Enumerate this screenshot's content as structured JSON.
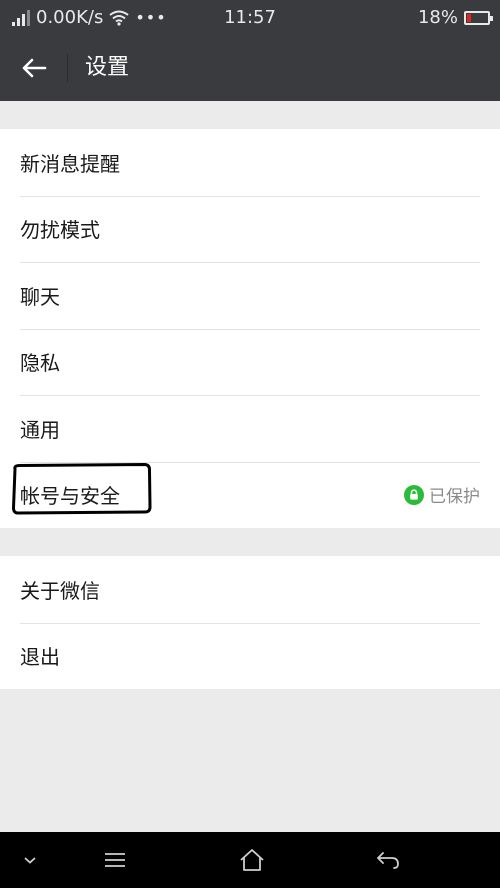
{
  "status_bar": {
    "net_speed": "0.00K/s",
    "more": "•••",
    "time": "11:57",
    "battery_percent": "18%",
    "battery_level": 0.18
  },
  "header": {
    "title": "设置",
    "back_icon": "arrow-left-icon"
  },
  "settings": {
    "group1": [
      {
        "label": "新消息提醒"
      },
      {
        "label": "勿扰模式"
      },
      {
        "label": "聊天"
      },
      {
        "label": "隐私"
      },
      {
        "label": "通用"
      },
      {
        "label": "帐号与安全",
        "status": "已保护",
        "status_icon": "lock-icon"
      }
    ],
    "group2": [
      {
        "label": "关于微信"
      },
      {
        "label": "退出"
      }
    ]
  },
  "nav_bar": {
    "icons": [
      "chevron-down-icon",
      "menu-icon",
      "home-icon",
      "back-icon"
    ]
  },
  "colors": {
    "titlebar": "#3a3b3f",
    "background": "#ebebeb",
    "protect_green": "#2bbb3a",
    "battery_low": "#e0261a"
  }
}
